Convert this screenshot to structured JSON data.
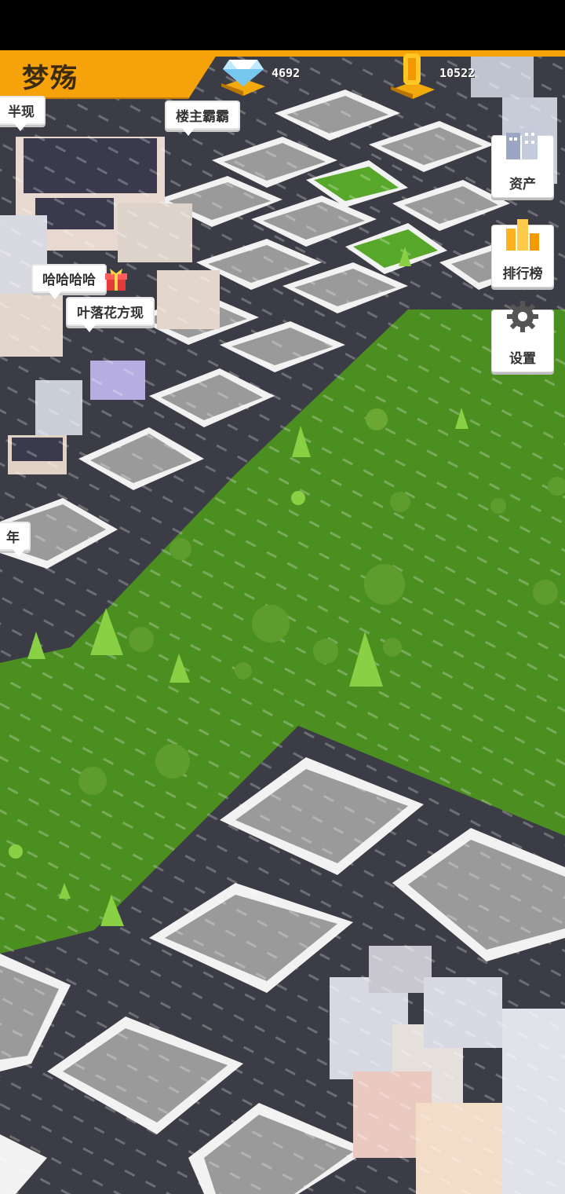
{
  "player": {
    "name": "梦殇"
  },
  "resources": [
    {
      "name": "diamonds",
      "icon": "diamond-icon",
      "value": "4692"
    },
    {
      "name": "coins",
      "icon": "coin-icon",
      "value": "10522"
    }
  ],
  "side_menu": [
    {
      "id": "assets",
      "label": "资产",
      "icon": "buildings-icon"
    },
    {
      "id": "leaderboard",
      "label": "排行榜",
      "icon": "trophy-icon"
    },
    {
      "id": "settings",
      "label": "设置",
      "icon": "gear-icon"
    }
  ],
  "bubbles": [
    {
      "text": "半现"
    },
    {
      "text": "楼主霸霸"
    },
    {
      "text": "哈哈哈哈"
    },
    {
      "text": "叶落花方现"
    },
    {
      "text": "年"
    }
  ],
  "colors": {
    "header_orange": "#f6a20a",
    "grass": "#4c8f21",
    "road": "#3c3c46",
    "lot": "#9a9a9a",
    "curb": "#f2f2f2"
  }
}
